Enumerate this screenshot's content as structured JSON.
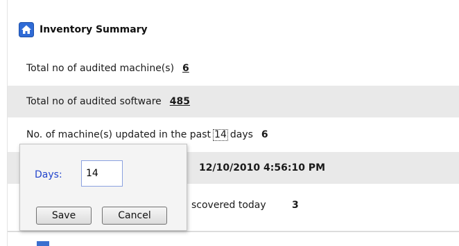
{
  "header": {
    "title": "Inventory Summary",
    "icon": "home-icon",
    "icon_color": "#2f6bd6"
  },
  "rows": [
    {
      "label": "Total no of audited machine(s)",
      "value": "6"
    },
    {
      "label": "Total no of audited software",
      "value": "485"
    },
    {
      "label_before": "No. of machine(s) updated in the past",
      "days": "14",
      "label_after": "days",
      "value": "6"
    },
    {
      "value": "12/10/2010 4:56:10 PM"
    },
    {
      "label": "scovered today",
      "value": "3"
    }
  ],
  "popup": {
    "label": "Days:",
    "input_value": "14",
    "save_label": "Save",
    "cancel_label": "Cancel"
  },
  "colors": {
    "shaded_row": "#e9e9e9",
    "popup_label": "#2244cc",
    "input_border": "#8aa0e0"
  }
}
